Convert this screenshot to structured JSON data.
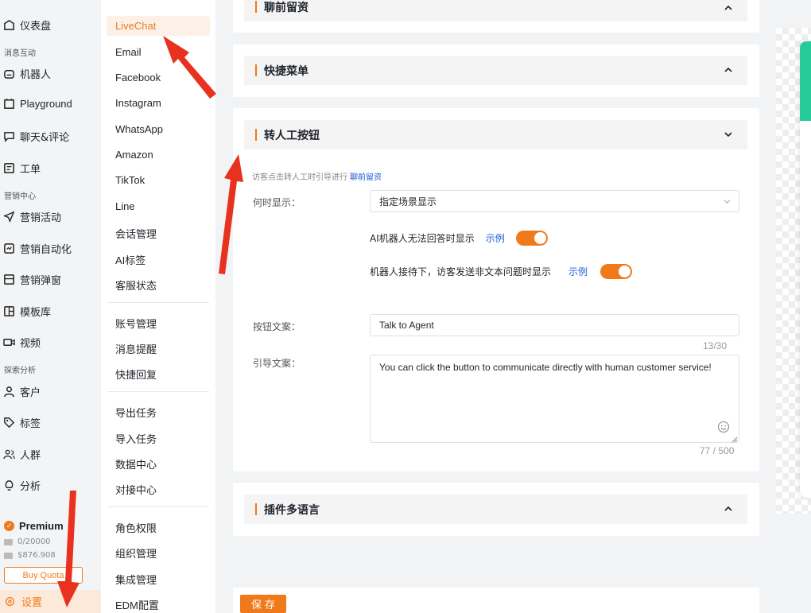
{
  "nav": {
    "dashboard": "仪表盘",
    "group_messaging": "消息互动",
    "robot": "机器人",
    "playground": "Playground",
    "chat_review": "聊天&评论",
    "ticket": "工单",
    "group_marketing": "营销中心",
    "campaign": "营销活动",
    "automation": "营销自动化",
    "popup": "营销弹窗",
    "templates": "模板库",
    "video": "视频",
    "group_analysis": "探索分析",
    "customer": "客户",
    "tags": "标签",
    "audience": "人群",
    "analysis": "分析",
    "premium": "Premium",
    "quota_messages": "0/20000",
    "quota_balance": "$876.908",
    "buy_quota": "Buy Quota",
    "settings": "设置"
  },
  "submenu": {
    "items": [
      "LiveChat",
      "Email",
      "Facebook",
      "Instagram",
      "WhatsApp",
      "Amazon",
      "TikTok",
      "Line",
      "会话管理",
      "AI标签",
      "客服状态"
    ],
    "items2": [
      "账号管理",
      "消息提醒",
      "快捷回复"
    ],
    "items3": [
      "导出任务",
      "导入任务",
      "数据中心",
      "对接中心"
    ],
    "items4": [
      "角色权限",
      "组织管理",
      "集成管理",
      "EDM配置"
    ]
  },
  "sections": {
    "pre_chat": "聊前留资",
    "quick_menu": "快捷菜单",
    "transfer_button": "转人工按钮",
    "multilang": "插件多语言"
  },
  "transfer": {
    "hint": "访客点击转人工时引导进行",
    "hint_link": "聊前留资",
    "when_label": "何时显示：",
    "when_value": "指定场景显示",
    "option1": "AI机器人无法回答时显示",
    "option2": "机器人接待下，访客发送非文本问题时显示",
    "example": "示例",
    "button_text_label": "按钮文案：",
    "button_text_value": "Talk to Agent",
    "button_text_count": "13/30",
    "guide_label": "引导文案：",
    "guide_value": "You can click the button to communicate directly with human customer service!",
    "guide_count": "77 / 500"
  },
  "save_label": "保存",
  "colors": {
    "accent": "#f07a1a",
    "link": "#1f5fd6",
    "preview": "#26c99a"
  }
}
